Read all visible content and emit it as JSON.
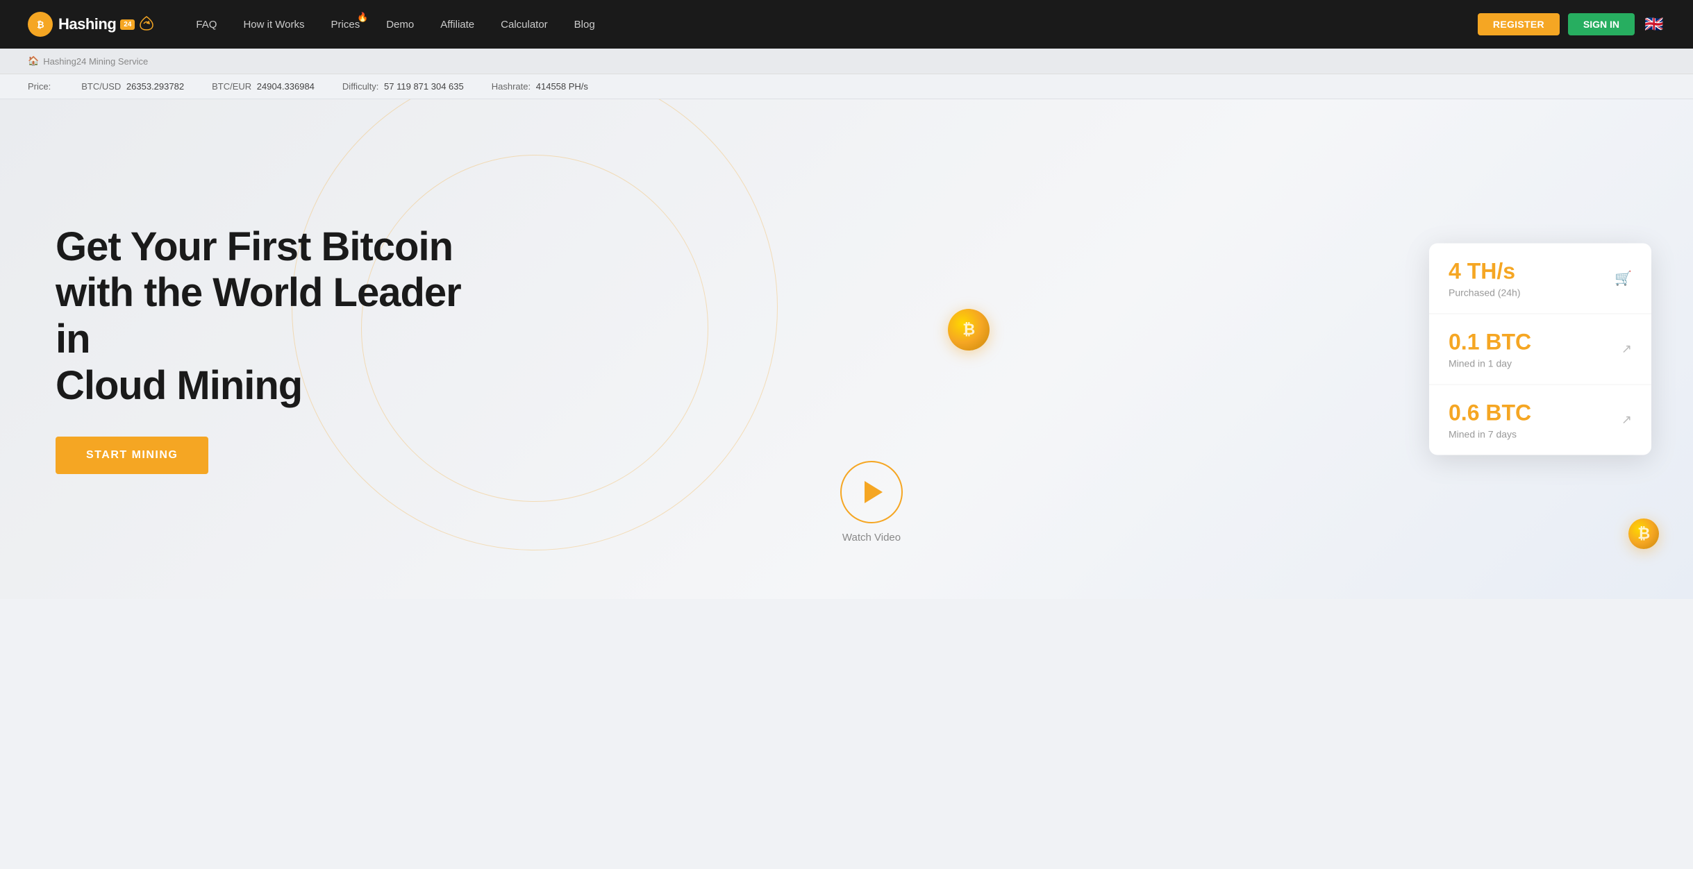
{
  "nav": {
    "logo_text": "Hashing",
    "logo_number": "24",
    "links": [
      {
        "id": "faq",
        "label": "FAQ",
        "has_fire": false
      },
      {
        "id": "how-it-works",
        "label": "How it Works",
        "has_fire": false
      },
      {
        "id": "prices",
        "label": "Prices",
        "has_fire": true
      },
      {
        "id": "demo",
        "label": "Demo",
        "has_fire": false
      },
      {
        "id": "affiliate",
        "label": "Affiliate",
        "has_fire": false
      },
      {
        "id": "calculator",
        "label": "Calculator",
        "has_fire": false
      },
      {
        "id": "blog",
        "label": "Blog",
        "has_fire": false
      }
    ],
    "register_label": "REGISTER",
    "signin_label": "SIGN IN",
    "flag_emoji": "🇬🇧"
  },
  "breadcrumb": {
    "home_icon": "🏠",
    "text": "Hashing24 Mining Service"
  },
  "ticker": {
    "price_label": "Price:",
    "btc_usd_label": "BTC/USD",
    "btc_usd_value": "26353.293782",
    "btc_eur_label": "BTC/EUR",
    "btc_eur_value": "24904.336984",
    "difficulty_label": "Difficulty:",
    "difficulty_value": "57 119 871 304 635",
    "hashrate_label": "Hashrate:",
    "hashrate_value": "414558 PH/s"
  },
  "hero": {
    "title_line1": "Get Your First Bitcoin",
    "title_line2": "with the World Leader in",
    "title_line3": "Cloud Mining",
    "start_mining_label": "START MINING",
    "watch_video_label": "Watch Video"
  },
  "stats": [
    {
      "value": "4 TH/s",
      "label": "Purchased (24h)",
      "icon": "🛒"
    },
    {
      "value": "0.1 BTC",
      "label": "Mined in 1 day",
      "icon": "↗"
    },
    {
      "value": "0.6 BTC",
      "label": "Mined in 7 days",
      "icon": "↗"
    }
  ],
  "colors": {
    "accent": "#f5a623",
    "dark": "#1a1a1a",
    "green": "#27ae60"
  }
}
